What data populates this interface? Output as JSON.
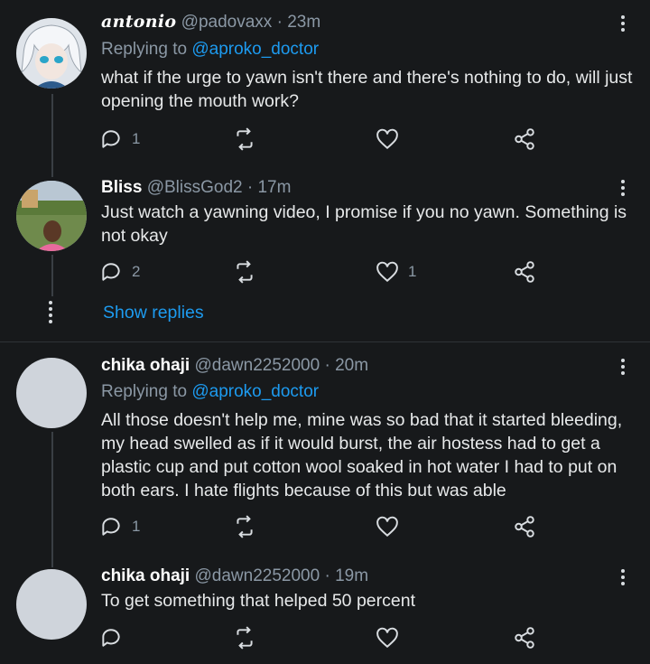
{
  "tweets": [
    {
      "name": "antonio",
      "handle": "@padovaxx",
      "time": "23m",
      "replying_prefix": "Replying to",
      "replying_handle": "@aproko_doctor",
      "text": "what if the urge to yawn isn't there and there's nothing to do, will just opening the mouth work?",
      "reply_count": "1",
      "like_count": ""
    },
    {
      "name": "Bliss",
      "handle": "@BlissGod2",
      "time": "17m",
      "text": "Just watch a yawning video, I promise if you no yawn. Something is not okay",
      "reply_count": "2",
      "like_count": "1"
    },
    {
      "name": "chika ohaji",
      "handle": "@dawn2252000",
      "time": "20m",
      "replying_prefix": "Replying to",
      "replying_handle": "@aproko_doctor",
      "text": "All those doesn't help me, mine was so bad that it started bleeding, my head swelled as if it would burst, the air hostess had to get a plastic cup and put cotton wool soaked in hot water I had to put on both ears. I hate flights because of this but was able",
      "reply_count": "1",
      "like_count": ""
    },
    {
      "name": "chika ohaji",
      "handle": "@dawn2252000",
      "time": "19m",
      "text": "To get something that helped 50 percent",
      "reply_count": "",
      "like_count": ""
    }
  ],
  "show_replies_label": "Show replies",
  "separator": "·",
  "colors": {
    "background": "#17191b",
    "link": "#1d9bf0",
    "muted": "#8b98a5",
    "text": "#e7e9ea"
  },
  "icons": [
    "reply-icon",
    "retweet-icon",
    "like-icon",
    "share-icon",
    "more-icon"
  ]
}
